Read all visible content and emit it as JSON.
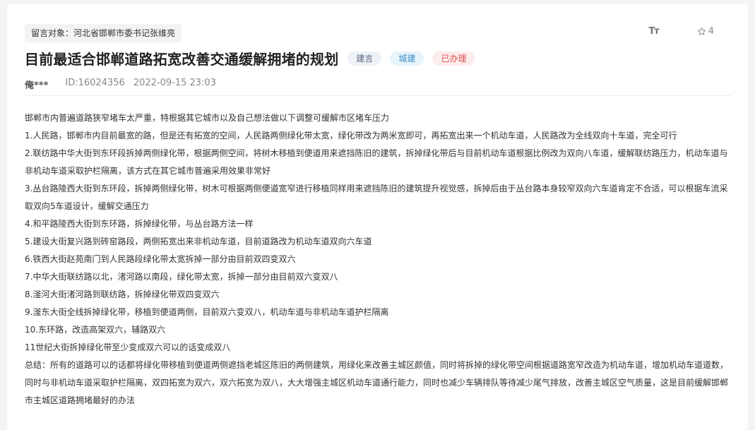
{
  "header": {
    "target": "留言对象：河北省邯郸市委书记张维亮",
    "font_size_icon": "Tт",
    "favorite_count": "4"
  },
  "post": {
    "title": "目前最适合邯郸道路拓宽改善交通缓解拥堵的规划",
    "tags": [
      "建言",
      "城建",
      "已办理"
    ],
    "author": "俺***",
    "id": "ID:16024356",
    "datetime": "2022-09-15 23:03"
  },
  "content": [
    "邯郸市内普遍道路狭窄堵车太严重，特根据其它城市以及自己想法做以下调整可缓解市区堵车压力",
    "1.人民路，邯郸市内目前最宽的路，但是还有拓宽的空间，人民路两侧绿化带太宽，绿化带改为两米宽即可，再拓宽出来一个机动车道，人民路改为全线双向十车道，完全可行",
    "2.联纺路中华大街到东环段拆掉两侧绿化带，根据两侧空间，将树木移植到便道用来遮挡陈旧的建筑，拆掉绿化带后与目前机动车道根据比例改为双向八车道，缓解联纺路压力，机动车道与非机动车道采取护栏隔离，该方式在其它城市普遍采用效果非常好",
    "3.丛台路陵西大街到东环段，拆掉两侧绿化带，树木可根据两侧便道宽窄进行移植同样用来遮挡陈旧的建筑提升视觉感，拆掉后由于丛台路本身较窄双向六车道肯定不合适，可以根据车流采取双向5车道设计，缓解交通压力",
    "4.和平路陵西大街到东环路，拆掉绿化带，与丛台路方法一样",
    "5.建设大街复兴路到砖窑路段，两侧拓宽出来非机动车道，目前道路改为机动车道双向六车道",
    "6.铁西大街赵苑南门到人民路段绿化带太宽拆掉一部分由目前双四变双六",
    "7.中华大街联纺路以北，渚河路以南段，绿化带太宽，拆掉一部分由目前双六变双八",
    "8.滏河大街渚河路到联纺路，拆掉绿化带双四变双六",
    "9.滏东大街全线拆掉绿化带，移植到便道两侧，目前双六变双八，机动车道与非机动车道护栏隔离",
    "10.东环路，改造高架双六，辅路双六",
    "11世纪大街拆掉绿化带至少变成双六可以的话变成双八",
    "总结：所有的道路可以的话都将绿化带移植到便道两侧遮挡老城区陈旧的两侧建筑，用绿化来改善主城区颜值，同时将拆掉的绿化带空间根据道路宽窄改造为机动车道，增加机动车道道数，同时与非机动车道采取护栏隔离，双四拓宽为双六，双六拓宽为双八，大大增强主城区机动车道通行能力，同时也减少车辆排队等待减少尾气排放，改善主城区空气质量，这是目前缓解邯郸市主城区道路拥堵最好的办法"
  ]
}
